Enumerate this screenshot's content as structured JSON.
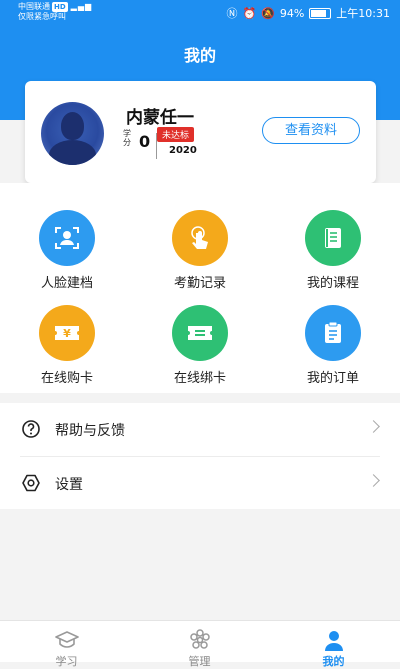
{
  "status_bar": {
    "carrier": "中国联通",
    "carrier_sub": "仅限紧急呼叫",
    "hd": "HD",
    "battery": "94%",
    "time": "上午10:31"
  },
  "header": {
    "title": "我的"
  },
  "profile": {
    "name": "内蒙任一",
    "credit_label": "学分",
    "credit_value": "0",
    "status_badge": "未达标",
    "year": "2020",
    "view_button": "查看资料"
  },
  "grid": [
    {
      "label": "人脸建档",
      "icon": "face-scan-icon",
      "color": "#2d9bf0"
    },
    {
      "label": "考勤记录",
      "icon": "tap-finger-icon",
      "color": "#f4a91b"
    },
    {
      "label": "我的课程",
      "icon": "book-icon",
      "color": "#2ec074"
    },
    {
      "label": "在线购卡",
      "icon": "yen-ticket-icon",
      "color": "#f4a91b"
    },
    {
      "label": "在线绑卡",
      "icon": "ticket-icon",
      "color": "#2ec074"
    },
    {
      "label": "我的订单",
      "icon": "clipboard-icon",
      "color": "#2d9bf0"
    }
  ],
  "menu": [
    {
      "label": "帮助与反馈",
      "icon": "help-icon"
    },
    {
      "label": "设置",
      "icon": "settings-icon"
    }
  ],
  "bottom_nav": [
    {
      "label": "学习",
      "icon": "graduation-cap-icon",
      "active": false
    },
    {
      "label": "管理",
      "icon": "gear-flower-icon",
      "active": false
    },
    {
      "label": "我的",
      "icon": "person-icon",
      "active": true
    }
  ],
  "colors": {
    "primary": "#1e8ff1",
    "badge": "#e0302a"
  }
}
